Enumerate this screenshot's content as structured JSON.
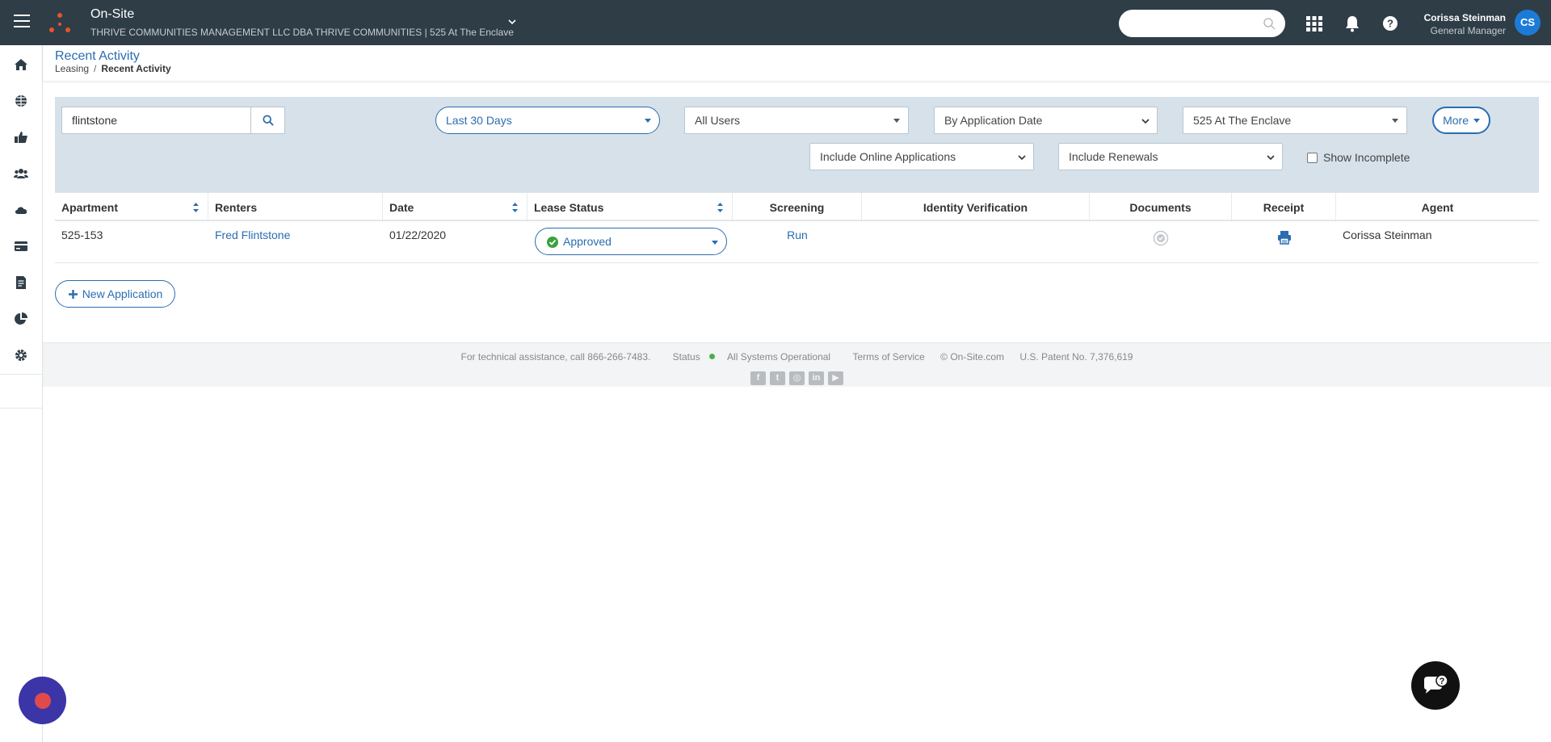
{
  "app": {
    "title": "On-Site",
    "company": "THRIVE COMMUNITIES MANAGEMENT LLC DBA THRIVE COMMUNITIES | 525 At The Enclave"
  },
  "search": {
    "placeholder": ""
  },
  "user": {
    "name": "Corissa Steinman",
    "role": "General Manager",
    "initials": "CS"
  },
  "sidebar": {
    "items": [
      {
        "icon": "home-icon"
      },
      {
        "icon": "globe-icon"
      },
      {
        "icon": "thumbs-up-icon"
      },
      {
        "icon": "users-icon"
      },
      {
        "icon": "cloud-icon"
      },
      {
        "icon": "credit-card-icon"
      },
      {
        "icon": "document-icon"
      },
      {
        "icon": "pie-chart-icon"
      },
      {
        "icon": "gear-icon"
      }
    ]
  },
  "page": {
    "title": "Recent Activity",
    "breadcrumb": [
      "Leasing",
      "Recent Activity"
    ]
  },
  "filters": {
    "search_value": "flintstone",
    "date_range": "Last 30 Days",
    "users": "All Users",
    "sort_by": "By Application Date",
    "property": "525 At The Enclave",
    "more_label": "More",
    "online_apps": "Include Online Applications",
    "renewals": "Include Renewals",
    "show_incomplete": "Show Incomplete",
    "show_incomplete_checked": false
  },
  "table": {
    "headers": [
      "Apartment",
      "Renters",
      "Date",
      "Lease Status",
      "Screening",
      "Identity Verification",
      "Documents",
      "Receipt",
      "Agent"
    ],
    "rows": [
      {
        "apartment": "525-153",
        "renters": "Fred Flintstone",
        "date": "01/22/2020",
        "lease_status": "Approved",
        "screening": "Run",
        "identity_verification": "",
        "agent": "Corissa Steinman"
      }
    ]
  },
  "actions": {
    "new_application": "New Application"
  },
  "footer": {
    "assistance": "For technical assistance, call 866-266-7483.",
    "status_label": "Status",
    "status_text": "All Systems Operational",
    "terms": "Terms of Service",
    "copyright": "© On-Site.com",
    "patent": "U.S. Patent No. 7,376,619"
  },
  "colors": {
    "topbar": "#2f3d47",
    "accent": "#2a6db0",
    "filter_panel": "#d6e1ea",
    "status_ok": "#3aa23c",
    "avatar": "#1d7bd8"
  }
}
